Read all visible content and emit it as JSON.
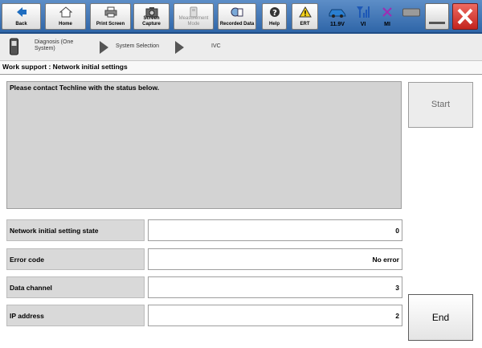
{
  "toolbar": {
    "back_label": "Back",
    "home_label": "Home",
    "print_label": "Print Screen",
    "capture_label": "Screen Capture",
    "measurement_label": "Measurement Mode",
    "recorded_label": "Recorded Data",
    "help_label": "Help",
    "ert_label": "ERT",
    "battery_label": "11.9V",
    "vi_label": "VI",
    "mi_label": "MI",
    "icons": {
      "back": "back-arrow-icon",
      "home": "home-icon",
      "print": "printer-icon",
      "capture": "camera-icon",
      "measurement": "meter-icon",
      "recorded": "recorded-data-icon",
      "help": "help-icon",
      "ert": "warning-triangle-icon",
      "battery": "car-icon",
      "vi": "signal-icon",
      "mi": "mi-x-icon",
      "keyboard": "keyboard-icon",
      "minimize": "minimize-icon",
      "close": "close-icon"
    }
  },
  "breadcrumb": {
    "item1": "Diagnosis (One System)",
    "item2": "System Selection",
    "item3": "IVC"
  },
  "page_title": "Work support : Network initial settings",
  "message": "Please contact Techline with the status below.",
  "rows": [
    {
      "label": "Network initial setting state",
      "value": "0"
    },
    {
      "label": "Error code",
      "value": "No error"
    },
    {
      "label": "Data channel",
      "value": "3"
    },
    {
      "label": "IP address",
      "value": "2"
    }
  ],
  "buttons": {
    "start": "Start",
    "end": "End"
  },
  "colors": {
    "toolbar_bg": "#2f66a8",
    "close_red": "#d9312b",
    "panel_gray": "#d3d3d3"
  }
}
